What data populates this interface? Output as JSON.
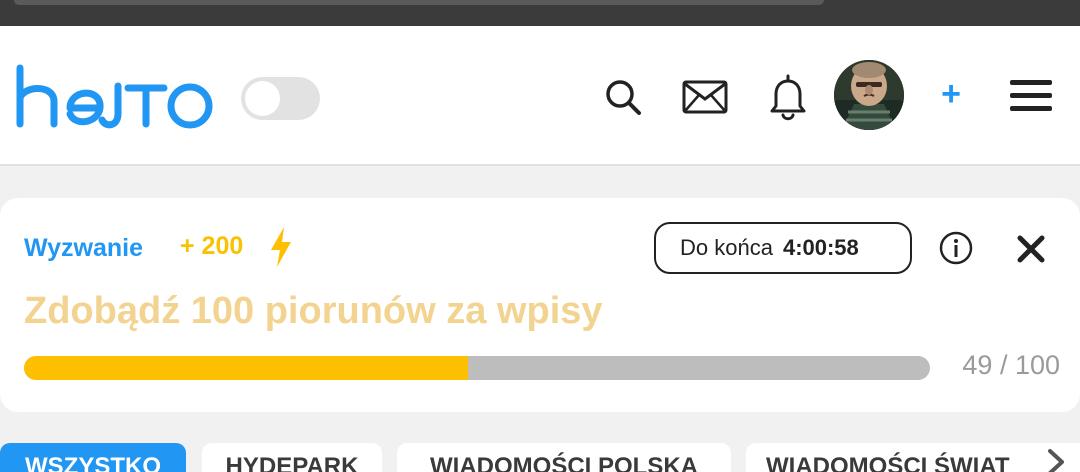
{
  "header": {
    "logo_text": "hejto",
    "icons": [
      "search-icon",
      "mail-icon",
      "bell-icon",
      "avatar",
      "add-icon",
      "menu-icon"
    ],
    "add_label": "+"
  },
  "challenge": {
    "label": "Wyzwanie",
    "reward": "+ 200",
    "countdown_label": "Do końca",
    "countdown_time": "4:00:58",
    "title": "Zdobądź 100 piorunów za wpisy",
    "progress_current": 49,
    "progress_total": 100,
    "progress_text": "49 / 100"
  },
  "tabs": [
    {
      "label": "WSZYSTKO",
      "active": true
    },
    {
      "label": "HYDEPARK",
      "active": false
    },
    {
      "label": "WIADOMOŚCI POLSKA",
      "active": false
    },
    {
      "label": "WIADOMOŚCI ŚWIAT",
      "active": false
    }
  ],
  "colors": {
    "brand_blue": "#2196f3",
    "reward_yellow": "#f9c200",
    "progress_fill": "#fdbf00",
    "title_gold": "#f2d38f"
  }
}
